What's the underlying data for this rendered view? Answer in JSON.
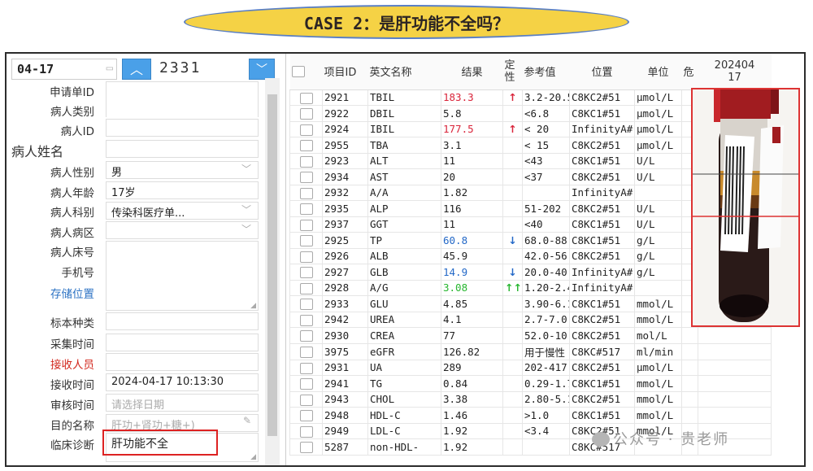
{
  "banner": {
    "title": "CASE 2：是肝功能不全吗？"
  },
  "header": {
    "date": "04-17",
    "sample_number": "2331"
  },
  "form": {
    "labels": {
      "request_id": "申请单ID",
      "patient_type": "病人类别",
      "patient_id": "病人ID",
      "patient_name": "病人姓名",
      "gender": "病人性别",
      "age": "病人年龄",
      "department": "病人科别",
      "ward": "病人病区",
      "bed": "病人床号",
      "phone": "手机号",
      "storage": "存储位置",
      "specimen_type": "标本种类",
      "collect_time": "采集时间",
      "receiver": "接收人员",
      "receive_time": "接收时间",
      "review_time": "审核时间",
      "purpose": "目的名称",
      "diagnosis": "临床诊断"
    },
    "values": {
      "gender": "男",
      "age": "17岁",
      "department": "传染科医疗单...",
      "receive_time": "2024-04-17 10:13:30",
      "review_time_placeholder": "请选择日期",
      "purpose": "肝功+肾功+糖+)",
      "diagnosis": "肝功能不全"
    }
  },
  "table": {
    "headers": [
      "项目ID",
      "英文名称",
      "结果",
      "定性",
      "参考值",
      "位置",
      "单位",
      "危",
      "202404\n17"
    ],
    "rows": [
      {
        "id": "2921",
        "name": "TBIL",
        "result": "183.3",
        "flag": "↑",
        "flag_color": "red",
        "ref": "3.2-20.5",
        "pos": "C8KC2#51",
        "unit": "μmol/L"
      },
      {
        "id": "2922",
        "name": "DBIL",
        "result": "5.8",
        "flag": "",
        "flag_color": "",
        "ref": "<6.8",
        "pos": "C8KC1#51",
        "unit": "μmol/L"
      },
      {
        "id": "2924",
        "name": "IBIL",
        "result": "177.5",
        "flag": "↑",
        "flag_color": "red",
        "ref": "< 20",
        "pos": "InfinityA#",
        "unit": "μmol/L"
      },
      {
        "id": "2955",
        "name": "TBA",
        "result": "3.1",
        "flag": "",
        "flag_color": "",
        "ref": "< 15",
        "pos": "C8KC2#51",
        "unit": "μmol/L"
      },
      {
        "id": "2923",
        "name": "ALT",
        "result": "11",
        "flag": "",
        "flag_color": "",
        "ref": "<43",
        "pos": "C8KC1#51",
        "unit": "U/L"
      },
      {
        "id": "2934",
        "name": "AST",
        "result": "20",
        "flag": "",
        "flag_color": "",
        "ref": "<37",
        "pos": "C8KC2#51",
        "unit": "U/L"
      },
      {
        "id": "2932",
        "name": "A/A",
        "result": "1.82",
        "flag": "",
        "flag_color": "",
        "ref": "",
        "pos": "InfinityA#",
        "unit": ""
      },
      {
        "id": "2935",
        "name": "ALP",
        "result": "116",
        "flag": "",
        "flag_color": "",
        "ref": "51-202",
        "pos": "C8KC2#51",
        "unit": "U/L"
      },
      {
        "id": "2937",
        "name": "GGT",
        "result": "11",
        "flag": "",
        "flag_color": "",
        "ref": "<40",
        "pos": "C8KC1#51",
        "unit": "U/L"
      },
      {
        "id": "2925",
        "name": "TP",
        "result": "60.8",
        "flag": "↓",
        "flag_color": "blue",
        "ref": "68.0-88",
        "pos": "C8KC1#51",
        "unit": "g/L"
      },
      {
        "id": "2926",
        "name": "ALB",
        "result": "45.9",
        "flag": "",
        "flag_color": "",
        "ref": "42.0-56",
        "pos": "C8KC2#51",
        "unit": "g/L"
      },
      {
        "id": "2927",
        "name": "GLB",
        "result": "14.9",
        "flag": "↓",
        "flag_color": "blue",
        "ref": "20.0-40",
        "pos": "InfinityA#",
        "unit": "g/L"
      },
      {
        "id": "2928",
        "name": "A/G",
        "result": "3.08",
        "flag": "↑↑",
        "flag_color": "green",
        "ref": "1.20-2.4",
        "pos": "InfinityA#",
        "unit": ""
      },
      {
        "id": "2933",
        "name": "GLU",
        "result": "4.85",
        "flag": "",
        "flag_color": "",
        "ref": "3.90-6.1",
        "pos": "C8KC1#51",
        "unit": "mmol/L"
      },
      {
        "id": "2942",
        "name": "UREA",
        "result": "4.1",
        "flag": "",
        "flag_color": "",
        "ref": "2.7-7.0",
        "pos": "C8KC2#51",
        "unit": "mmol/L"
      },
      {
        "id": "2930",
        "name": "CREA",
        "result": "77",
        "flag": "",
        "flag_color": "",
        "ref": "52.0-10",
        "pos": "C8KC2#51",
        "unit": "mol/L"
      },
      {
        "id": "3975",
        "name": "eGFR",
        "result": "126.82",
        "flag": "",
        "flag_color": "",
        "ref": "用于慢性",
        "pos": "C8KC#517",
        "unit": "ml/min"
      },
      {
        "id": "2931",
        "name": "UA",
        "result": "289",
        "flag": "",
        "flag_color": "",
        "ref": "202-417",
        "pos": "C8KC2#51",
        "unit": "μmol/L"
      },
      {
        "id": "2941",
        "name": "TG",
        "result": "0.84",
        "flag": "",
        "flag_color": "",
        "ref": "0.29-1.7",
        "pos": "C8KC1#51",
        "unit": "mmol/L"
      },
      {
        "id": "2943",
        "name": "CHOL",
        "result": "3.38",
        "flag": "",
        "flag_color": "",
        "ref": "2.80-5.1",
        "pos": "C8KC2#51",
        "unit": "mmol/L"
      },
      {
        "id": "2948",
        "name": "HDL-C",
        "result": "1.46",
        "flag": "",
        "flag_color": "",
        "ref": ">1.0",
        "pos": "C8KC1#51",
        "unit": "mmol/L"
      },
      {
        "id": "2949",
        "name": "LDL-C",
        "result": "1.92",
        "flag": "",
        "flag_color": "",
        "ref": "<3.4",
        "pos": "C8KC2#51",
        "unit": "mmol/L"
      },
      {
        "id": "5287",
        "name": "non-HDL-",
        "result": "1.92",
        "flag": "",
        "flag_color": "",
        "ref": "",
        "pos": "C8KC#517",
        "unit": ""
      }
    ]
  },
  "watermark": {
    "text": "公众号 · 贵老师"
  },
  "colors": {
    "banner": "#f5d245",
    "accent": "#4aa0e8",
    "high": "#d9243a",
    "low": "#2368c7",
    "very_high": "#27b62f"
  }
}
